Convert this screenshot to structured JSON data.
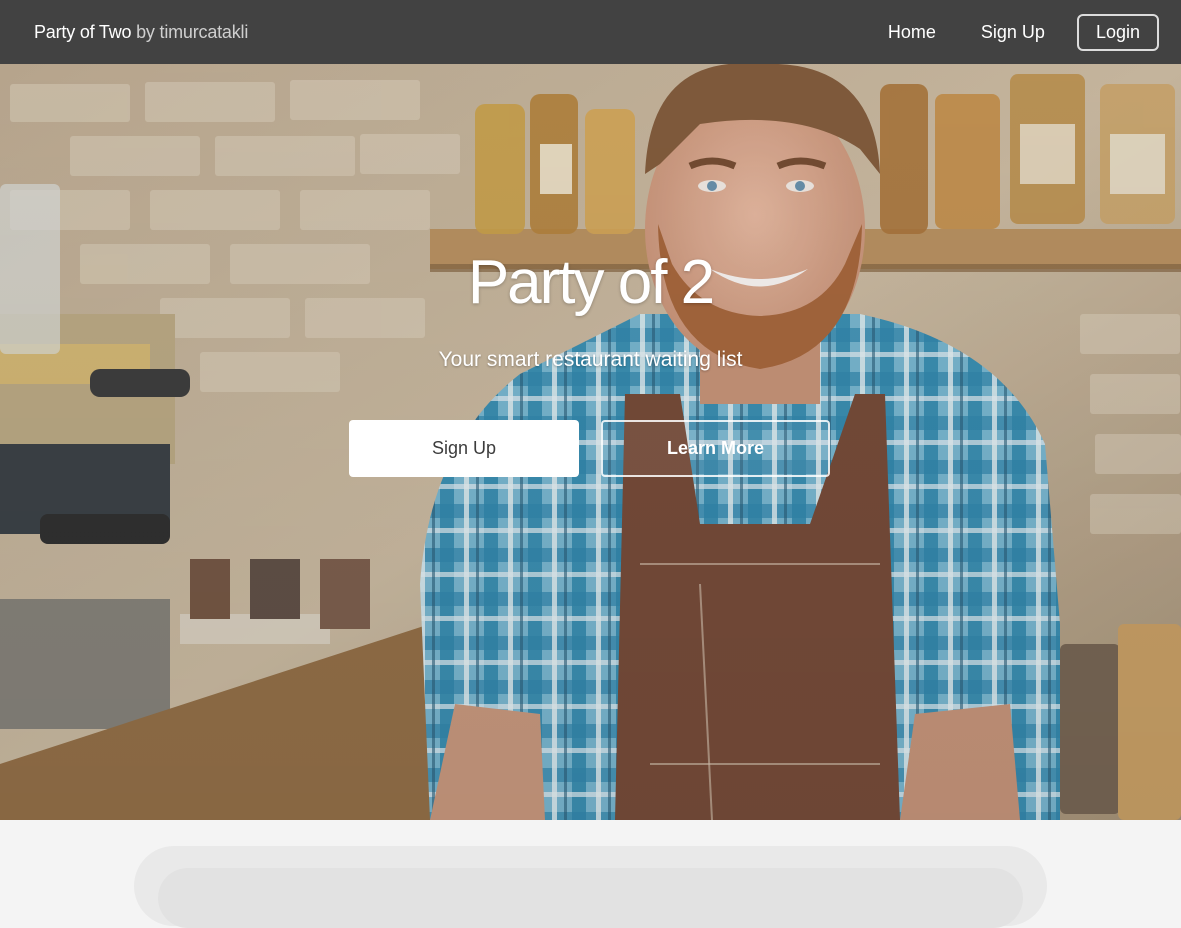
{
  "navbar": {
    "brand_name": "Party of Two",
    "brand_by": " by timurcatakli",
    "links": {
      "home": "Home",
      "signup": "Sign Up",
      "login": "Login"
    },
    "background_color": "#424242"
  },
  "hero": {
    "title": "Party of 2",
    "subtitle": "Your smart restaurant waiting list",
    "primary_button": "Sign Up",
    "secondary_button": "Learn More"
  }
}
